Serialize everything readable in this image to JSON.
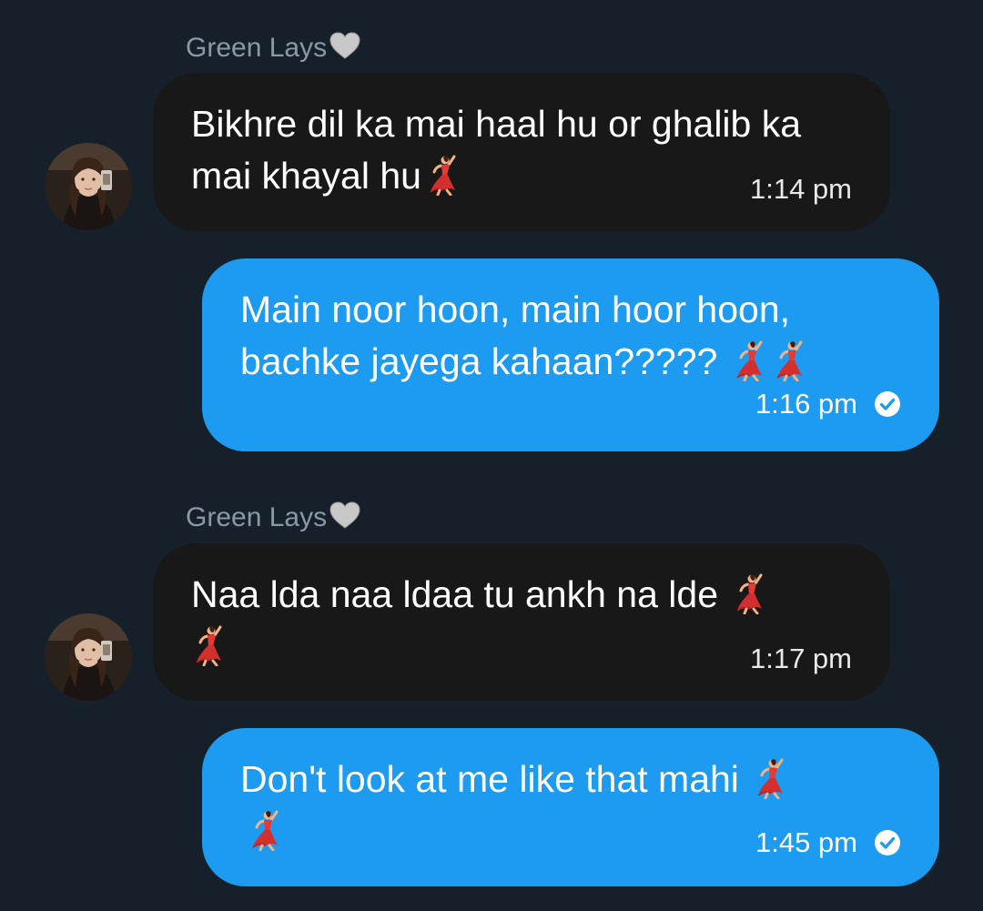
{
  "colors": {
    "background": "#15202b",
    "incoming_bubble": "#181818",
    "outgoing_bubble": "#1d9bf0",
    "sender_name": "#8b98a5"
  },
  "messages": [
    {
      "sender": "Green Lays",
      "sender_icon": "grey-heart-icon",
      "direction": "incoming",
      "text": "Bikhre dil ka mai haal hu or ghalib ka mai khayal hu",
      "emoji": [
        "dancer-emoji"
      ],
      "time": "1:14 pm"
    },
    {
      "direction": "outgoing",
      "text": "Main noor hoon, main hoor hoon, bachke jayega kahaan?????",
      "emoji": [
        "dancer-emoji",
        "dancer-emoji"
      ],
      "time": "1:16 pm",
      "status_icon": "sent-check-icon"
    },
    {
      "sender": "Green Lays",
      "sender_icon": "grey-heart-icon",
      "direction": "incoming",
      "text": "Naa lda naa ldaa tu ankh na lde",
      "emoji": [
        "dancer-emoji",
        "dancer-emoji"
      ],
      "time": "1:17 pm"
    },
    {
      "direction": "outgoing",
      "text": "Don't look at me like that mahi",
      "emoji": [
        "dancer-emoji",
        "dancer-emoji"
      ],
      "time": "1:45 pm",
      "status_icon": "sent-check-icon"
    }
  ]
}
